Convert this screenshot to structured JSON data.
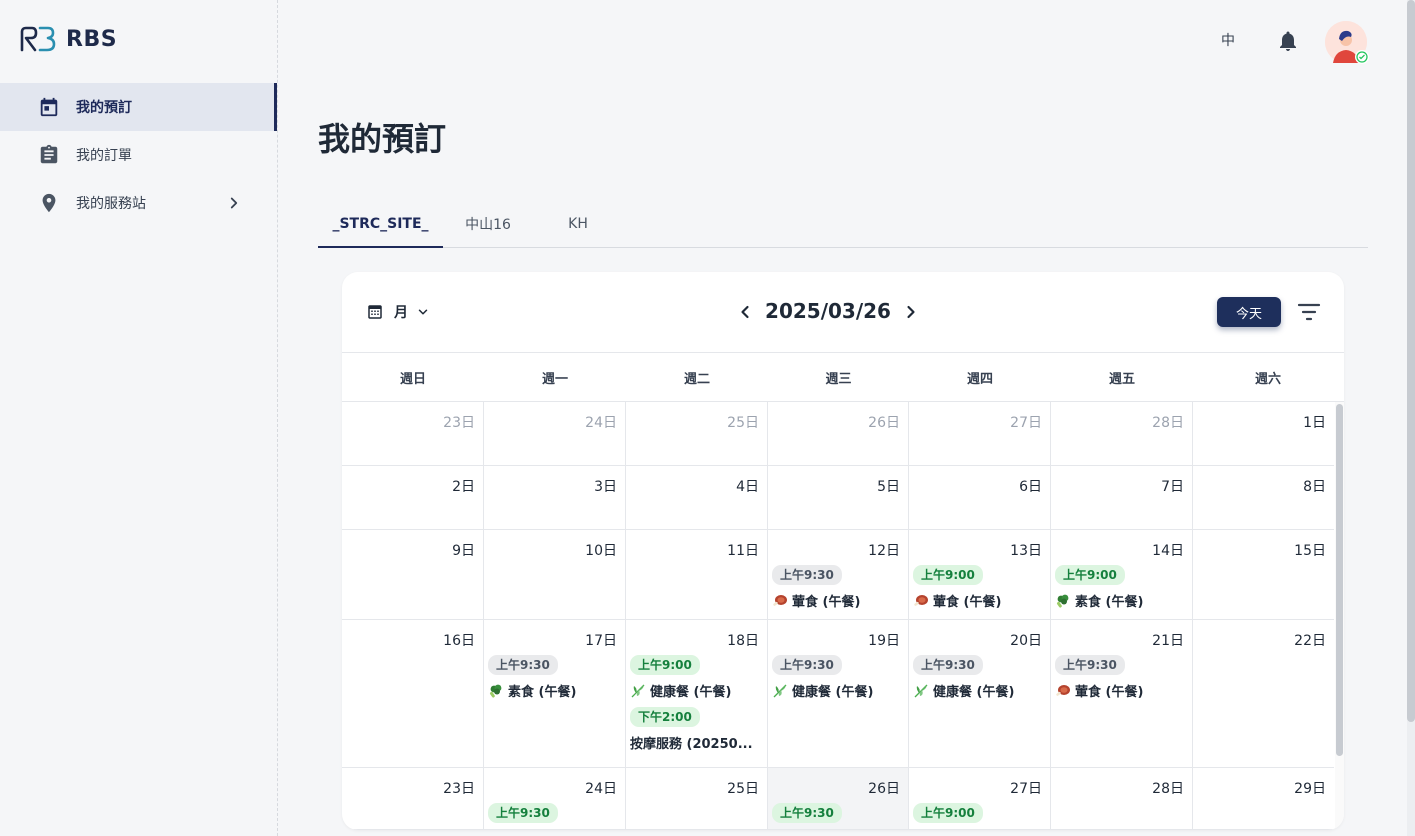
{
  "app": {
    "name": "RBS"
  },
  "sidebar": {
    "items": [
      {
        "label": "我的預訂",
        "icon": "calendar-icon",
        "active": true
      },
      {
        "label": "我的訂單",
        "icon": "clipboard-icon",
        "active": false
      },
      {
        "label": "我的服務站",
        "icon": "location-pin-icon",
        "active": false,
        "has_children": true
      }
    ]
  },
  "header": {
    "language": "中",
    "notifications_icon": "bell-icon",
    "avatar_icon": "user-avatar-icon"
  },
  "page": {
    "title": "我的預訂"
  },
  "tabs": [
    {
      "label": "_STRC_SITE_",
      "active": true
    },
    {
      "label": "中山16",
      "active": false
    },
    {
      "label": "KH",
      "active": false
    }
  ],
  "calendar": {
    "view_label": "月",
    "current_date": "2025/03/26",
    "today_label": "今天",
    "weekdays": [
      "週日",
      "週一",
      "週二",
      "週三",
      "週四",
      "週五",
      "週六"
    ],
    "weeks": [
      [
        {
          "day": "23日",
          "other": true
        },
        {
          "day": "24日",
          "other": true
        },
        {
          "day": "25日",
          "other": true
        },
        {
          "day": "26日",
          "other": true
        },
        {
          "day": "27日",
          "other": true
        },
        {
          "day": "28日",
          "other": true
        },
        {
          "day": "1日"
        }
      ],
      [
        {
          "day": "2日"
        },
        {
          "day": "3日"
        },
        {
          "day": "4日"
        },
        {
          "day": "5日"
        },
        {
          "day": "6日"
        },
        {
          "day": "7日"
        },
        {
          "day": "8日"
        }
      ],
      [
        {
          "day": "9日"
        },
        {
          "day": "10日"
        },
        {
          "day": "11日"
        },
        {
          "day": "12日",
          "events": [
            {
              "time": "上午9:30",
              "status": "past",
              "emoji": "meat",
              "title": "葷食 (午餐)"
            }
          ]
        },
        {
          "day": "13日",
          "events": [
            {
              "time": "上午9:00",
              "status": "up",
              "emoji": "meat",
              "title": "葷食 (午餐)"
            }
          ]
        },
        {
          "day": "14日",
          "events": [
            {
              "time": "上午9:00",
              "status": "up",
              "emoji": "broccoli",
              "title": "素食 (午餐)"
            }
          ]
        },
        {
          "day": "15日"
        }
      ],
      [
        {
          "day": "16日"
        },
        {
          "day": "17日",
          "events": [
            {
              "time": "上午9:30",
              "status": "past",
              "emoji": "broccoli",
              "title": "素食 (午餐)"
            }
          ]
        },
        {
          "day": "18日",
          "events": [
            {
              "time": "上午9:00",
              "status": "up",
              "emoji": "herb",
              "title": "健康餐 (午餐)"
            },
            {
              "time": "下午2:00",
              "status": "up",
              "emoji": "",
              "title": "按摩服務 (20250..."
            }
          ]
        },
        {
          "day": "19日",
          "events": [
            {
              "time": "上午9:30",
              "status": "past",
              "emoji": "herb",
              "title": "健康餐 (午餐)"
            }
          ]
        },
        {
          "day": "20日",
          "events": [
            {
              "time": "上午9:30",
              "status": "past",
              "emoji": "herb",
              "title": "健康餐 (午餐)"
            }
          ]
        },
        {
          "day": "21日",
          "events": [
            {
              "time": "上午9:30",
              "status": "past",
              "emoji": "meat",
              "title": "葷食 (午餐)"
            }
          ]
        },
        {
          "day": "22日"
        }
      ],
      [
        {
          "day": "23日"
        },
        {
          "day": "24日",
          "events": [
            {
              "time": "上午9:30",
              "status": "up",
              "emoji": "",
              "title": ""
            }
          ]
        },
        {
          "day": "25日"
        },
        {
          "day": "26日",
          "today": true,
          "events": [
            {
              "time": "上午9:30",
              "status": "up",
              "emoji": "",
              "title": ""
            }
          ]
        },
        {
          "day": "27日",
          "events": [
            {
              "time": "上午9:00",
              "status": "up",
              "emoji": "",
              "title": ""
            }
          ]
        },
        {
          "day": "28日"
        },
        {
          "day": "29日"
        }
      ]
    ]
  },
  "colors": {
    "primary": "#1e2f5c",
    "upcoming_bg": "#dcf5e0",
    "upcoming_text": "#15803d",
    "past_bg": "#e9eaec"
  }
}
